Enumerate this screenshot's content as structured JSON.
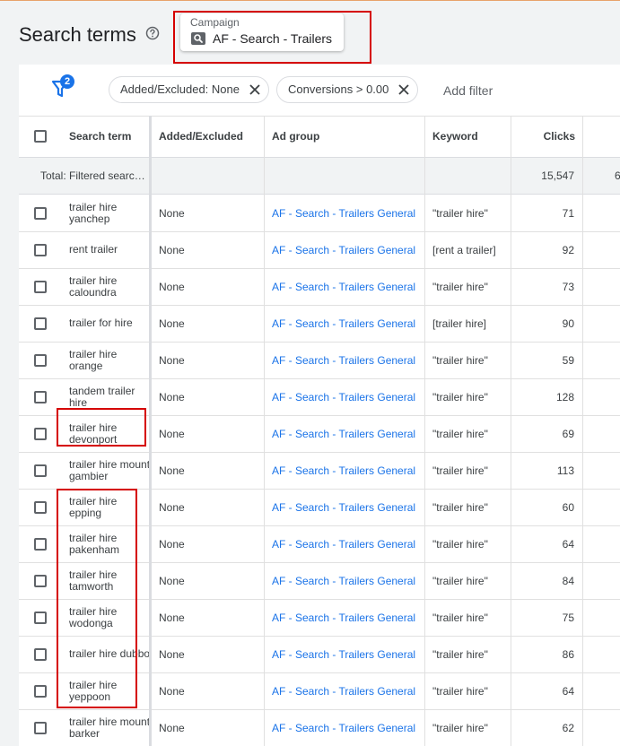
{
  "page": {
    "title": "Search terms"
  },
  "campaign": {
    "label": "Campaign",
    "name": "AF - Search - Trailers"
  },
  "filters": {
    "count": "2",
    "chips": [
      "Added/Excluded: None",
      "Conversions > 0.00"
    ],
    "add_label": "Add filter"
  },
  "table": {
    "columns": {
      "term": "Search term",
      "added": "Added/Excluded",
      "adgroup": "Ad group",
      "keyword": "Keyword",
      "clicks": "Clicks"
    },
    "total": {
      "label": "Total: Filtered search ...",
      "clicks": "15,547",
      "next_col": "6"
    },
    "rows": [
      {
        "term": "trailer hire yanchep",
        "added": "None",
        "adgroup": "AF - Search - Trailers General",
        "keyword": "\"trailer hire\"",
        "clicks": "71"
      },
      {
        "term": "rent trailer",
        "added": "None",
        "adgroup": "AF - Search - Trailers General",
        "keyword": "[rent a trailer]",
        "clicks": "92"
      },
      {
        "term": "trailer hire caloundra",
        "added": "None",
        "adgroup": "AF - Search - Trailers General",
        "keyword": "\"trailer hire\"",
        "clicks": "73"
      },
      {
        "term": "trailer for hire",
        "added": "None",
        "adgroup": "AF - Search - Trailers General",
        "keyword": "[trailer hire]",
        "clicks": "90"
      },
      {
        "term": "trailer hire orange",
        "added": "None",
        "adgroup": "AF - Search - Trailers General",
        "keyword": "\"trailer hire\"",
        "clicks": "59"
      },
      {
        "term": "tandem trailer hire",
        "added": "None",
        "adgroup": "AF - Search - Trailers General",
        "keyword": "\"trailer hire\"",
        "clicks": "128"
      },
      {
        "term": "trailer hire devonport",
        "added": "None",
        "adgroup": "AF - Search - Trailers General",
        "keyword": "\"trailer hire\"",
        "clicks": "69"
      },
      {
        "term": "trailer hire mount gambier",
        "added": "None",
        "adgroup": "AF - Search - Trailers General",
        "keyword": "\"trailer hire\"",
        "clicks": "113"
      },
      {
        "term": "trailer hire epping",
        "added": "None",
        "adgroup": "AF - Search - Trailers General",
        "keyword": "\"trailer hire\"",
        "clicks": "60"
      },
      {
        "term": "trailer hire pakenham",
        "added": "None",
        "adgroup": "AF - Search - Trailers General",
        "keyword": "\"trailer hire\"",
        "clicks": "64"
      },
      {
        "term": "trailer hire tamworth",
        "added": "None",
        "adgroup": "AF - Search - Trailers General",
        "keyword": "\"trailer hire\"",
        "clicks": "84"
      },
      {
        "term": "trailer hire wodonga",
        "added": "None",
        "adgroup": "AF - Search - Trailers General",
        "keyword": "\"trailer hire\"",
        "clicks": "75"
      },
      {
        "term": "trailer hire dubbo",
        "added": "None",
        "adgroup": "AF - Search - Trailers General",
        "keyword": "\"trailer hire\"",
        "clicks": "86"
      },
      {
        "term": "trailer hire yeppoon",
        "added": "None",
        "adgroup": "AF - Search - Trailers General",
        "keyword": "\"trailer hire\"",
        "clicks": "64"
      },
      {
        "term": "trailer hire mount barker",
        "added": "None",
        "adgroup": "AF - Search - Trailers General",
        "keyword": "\"trailer hire\"",
        "clicks": "62"
      }
    ]
  },
  "colors": {
    "link": "#1a73e8",
    "highlight": "#d50000",
    "accent_line": "#e8a26a"
  },
  "icons": {
    "help": "help-circle-icon",
    "campaign": "search-campaign-icon",
    "filter": "filter-icon",
    "chip_close": "close-icon",
    "checkbox": "checkbox-icon"
  }
}
